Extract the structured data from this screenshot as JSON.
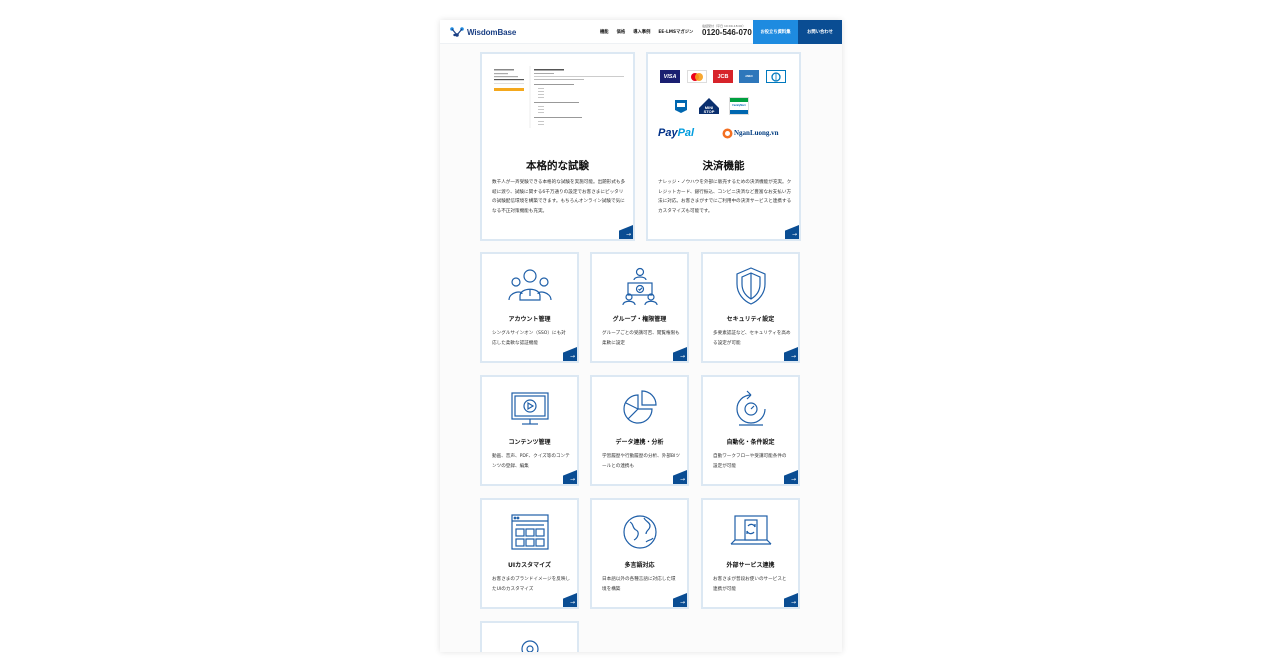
{
  "header": {
    "logo_text": "WisdomBase",
    "nav": [
      "機能",
      "価格",
      "導入事例",
      "EE-LMSマガジン"
    ],
    "phone_label": "電話受付（平日 10:00-18:00）",
    "phone_number": "0120-546-070",
    "doc_button": "お役立ち資料集",
    "contact_button": "お問い合わせ"
  },
  "cards_big": [
    {
      "title": "本格的な試験",
      "desc": "数千人が一斉受験できる本格的な試験を実施可能。出題形式も多岐に渡り、試験に関する6千万通りの設定でお客さまにピッタリの試験配信環境を構築できます。もちろんオンライン試験で気になる不正対策機能も充実。"
    },
    {
      "title": "決済機能",
      "desc": "ナレッジ・ノウハウを外部に販売するための決済機能が充実。クレジットカード、銀行振込、コンビニ決済など豊富なお支払い方法に対応。お客さまがすでにご利用中の決済サービスと連携するカスタマイズも可能です。"
    }
  ],
  "payment_logos": [
    "VISA",
    "mastercard",
    "JCB",
    "AMERICAN EXPRESS",
    "Diners Club",
    "LAWSON",
    "MINI STOP",
    "FamilyMart",
    "PayPal",
    "NganLuong.vn"
  ],
  "cards_small": [
    {
      "title": "アカウント管理",
      "desc": "シングルサインオン（SSO）にも対応した柔軟な認証機能",
      "icon": "account-users-icon"
    },
    {
      "title": "グループ・権限管理",
      "desc": "グループごとの受講可否、閲覧権限も柔軟に設定",
      "icon": "group-permission-icon"
    },
    {
      "title": "セキュリティ設定",
      "desc": "多要素認証など、セキュリティを高める設定が可能",
      "icon": "shield-icon"
    },
    {
      "title": "コンテンツ管理",
      "desc": "動画、音声、PDF、クイズ等のコンテンツの登録、編集",
      "icon": "monitor-play-icon"
    },
    {
      "title": "データ連携・分析",
      "desc": "学習履歴や行動履歴の分析、外部BIツールとの連携も",
      "icon": "pie-chart-icon"
    },
    {
      "title": "自動化・条件設定",
      "desc": "自動ワークフローや受講可能条件の設定が可能",
      "icon": "automation-cycle-icon"
    },
    {
      "title": "UIカスタマイズ",
      "desc": "お客さまのブランドイメージを反映したUIのカスタマイズ",
      "icon": "browser-layout-icon"
    },
    {
      "title": "多言語対応",
      "desc": "日本語以外の各種言語に対応した環境を構築",
      "icon": "globe-icon"
    },
    {
      "title": "外部サービス連携",
      "desc": "お客さまが普段お使いのサービスと連携が可能",
      "icon": "devices-sync-icon"
    }
  ],
  "colors": {
    "brand_dark": "#0a4d93",
    "brand_light": "#1e8be0",
    "card_border": "#dce8f3",
    "icon_blue": "#1f5fa8"
  }
}
